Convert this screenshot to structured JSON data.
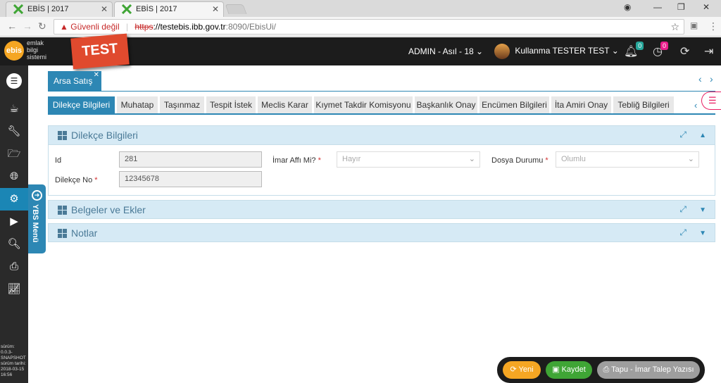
{
  "browser": {
    "tabs": [
      {
        "title": "EBİS | 2017"
      },
      {
        "title": "EBİS | 2017"
      }
    ],
    "security_label": "Güvenli değil",
    "url_scheme": "https",
    "url_host": "://testebis.ibb.gov.tr",
    "url_path": ":8090/EbisUi/"
  },
  "header": {
    "logo_short": "ebis",
    "logo_lines": [
      "emlak",
      "bilgi",
      "sistemi"
    ],
    "test_badge": "TEST",
    "role": "ADMIN - Asıl - 18",
    "user": "Kullanma TESTER TEST",
    "notifications_count": "0",
    "tasks_count": "0"
  },
  "sidebar": {
    "version_lines": [
      "sürüm:",
      "0.0.3-",
      "SNAPSHOT",
      "sürüm tarihi:",
      "2018-03-15",
      "16:56"
    ],
    "ybs_menu": "YBS Menü"
  },
  "page_tab": {
    "label": "Arsa Satış"
  },
  "subtabs": [
    "Dilekçe Bilgileri",
    "Muhatap",
    "Taşınmaz",
    "Tespit İstek",
    "Meclis Karar",
    "Kıymet Takdir Komisyonu",
    "Başkanlık Onay",
    "Encümen Bilgileri",
    "İta Amiri Onay",
    "Tebliğ Bilgileri"
  ],
  "panels": {
    "dilekce_title": "Dilekçe Bilgileri",
    "belgeler_title": "Belgeler ve Ekler",
    "notlar_title": "Notlar"
  },
  "form": {
    "id_label": "Id",
    "id_value": "281",
    "dilekce_no_label": "Dilekçe No",
    "dilekce_no_value": "12345678",
    "imar_affi_label": "İmar Affı Mi?",
    "imar_affi_value": "Hayır",
    "dosya_durumu_label": "Dosya Durumu",
    "dosya_durumu_value": "Olumlu",
    "required_mark": "*"
  },
  "actions": {
    "new_label": "Yeni",
    "save_label": "Kaydet",
    "print_label": "Tapu - İmar Talep Yazısı"
  },
  "colors": {
    "accent": "#2d87b4",
    "panel_bg": "#d6eaf5",
    "test_badge": "#e04a2e",
    "new_button": "#f5a623",
    "save_button": "#3fa535",
    "print_button": "#9e9e9e",
    "notification_badge": "#26a69a",
    "task_badge": "#e91e8c"
  }
}
